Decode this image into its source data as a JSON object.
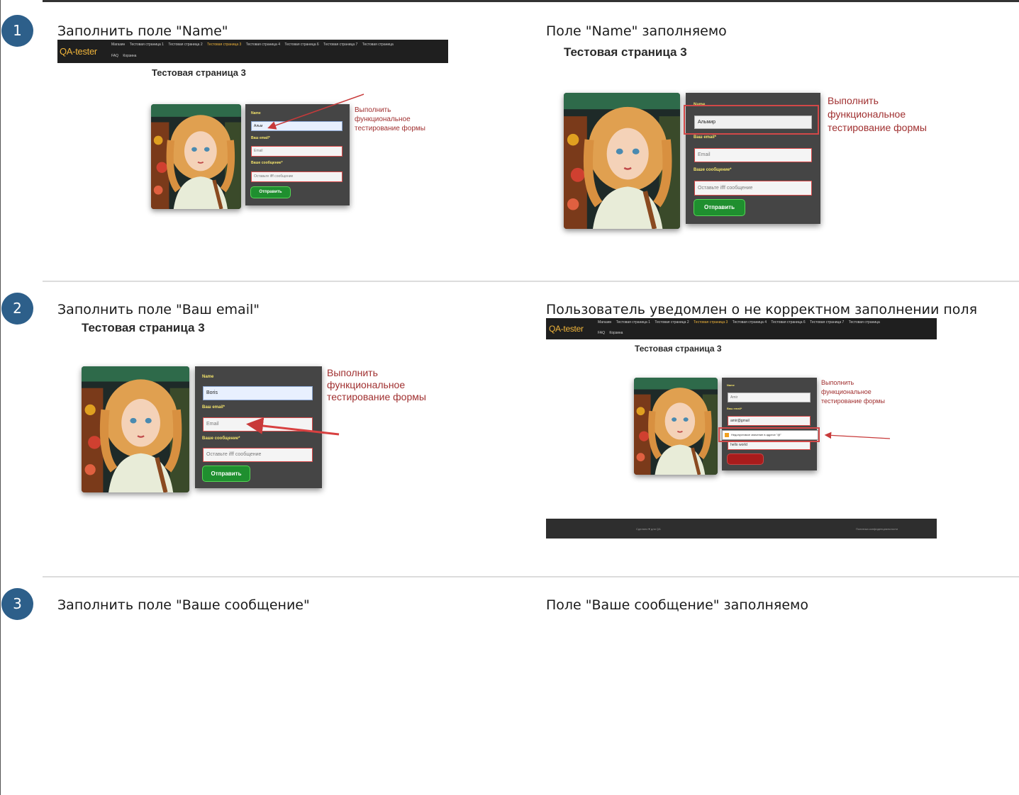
{
  "steps": [
    {
      "number": "1",
      "action": "Заполнить поле \"Name\"",
      "result": "Поле \"Name\" заполняемо"
    },
    {
      "number": "2",
      "action": "Заполнить поле \"Ваш email\"",
      "result": "Пользователь уведомлен о не корректном заполнении поля"
    },
    {
      "number": "3",
      "action": "Заполнить поле \"Ваше сообщение\"",
      "result": "Поле \"Ваше сообщение\" заполняемо"
    }
  ],
  "site": {
    "logo": "QA-tester",
    "nav_links": [
      "Магазин",
      "Тестовая страница 1",
      "Тестовая страница 2",
      "Тестовая страница 3",
      "Тестовая страница 4",
      "Тестовая страница 6",
      "Тестовая страница 7",
      "Тестовая страница"
    ],
    "nav_links_row2": [
      "FAQ",
      "Корзина"
    ],
    "active_nav": "Тестовая страница 3",
    "page_title": "Тестовая страница 3",
    "form": {
      "name_label": "Name",
      "email_label": "Ваш email*",
      "message_label": "Ваше сообщение*",
      "email_placeholder": "Email",
      "message_placeholder": "Оставьте ifff сообщение",
      "submit": "Отправить"
    },
    "annotation_lines": [
      "Выполнить",
      "функциональное",
      "тестирование формы"
    ],
    "footer_left": "Сделано ♥ для QA",
    "footer_right": "Политика конфиденциальности"
  },
  "shots": {
    "s1_left_name_value": "Альм",
    "s1_right_name_value": "Альмир",
    "s2_left_name_value": "Boris",
    "s2_right_name_value": "Amir",
    "s2_right_email_value": "amir@gmail",
    "s2_right_message_value": "hello world",
    "s2_right_tooltip": "Недопустимое значение в адресе \"@\"",
    "s2_right_name_label": "Name"
  },
  "colors": {
    "step_badge": "#2d5f8a",
    "annotation": "#a03030",
    "submit_green": "#1f8f2f",
    "submit_error": "#a81c1c",
    "label_yellow": "#f2e26a",
    "logo_orange": "#f0b43a"
  }
}
